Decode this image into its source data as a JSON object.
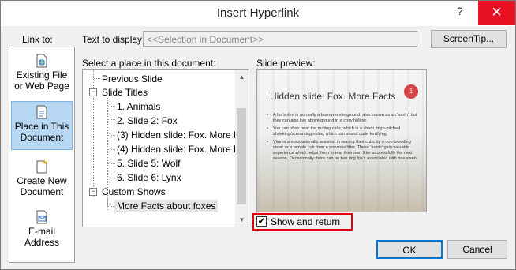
{
  "window": {
    "title": "Insert Hyperlink",
    "help": "?",
    "close": "✕"
  },
  "link_to": {
    "label": "Link to:",
    "items": [
      {
        "line1": "Existing File",
        "line2": "or Web Page",
        "icon": "globe-file-icon"
      },
      {
        "line1": "Place in This",
        "line2": "Document",
        "icon": "document-place-icon",
        "selected": true
      },
      {
        "line1": "Create New",
        "line2": "Document",
        "icon": "new-document-icon"
      },
      {
        "line1": "E-mail",
        "line2": "Address",
        "icon": "email-icon"
      }
    ]
  },
  "text_to_display": {
    "label": "Text to display:",
    "value": "<<Selection in Document>>"
  },
  "screentip": {
    "label": "ScreenTip..."
  },
  "place": {
    "label": "Select a place in this document:",
    "items": [
      {
        "text": "Previous Slide"
      },
      {
        "text": "Slide Titles"
      },
      {
        "text": "1. Animals"
      },
      {
        "text": "2. Slide 2: Fox"
      },
      {
        "text": "(3) Hidden slide: Fox. More F"
      },
      {
        "text": "(4) Hidden slide: Fox. More F"
      },
      {
        "text": "5. Slide 5: Wolf"
      },
      {
        "text": "6. Slide 6: Lynx"
      },
      {
        "text": "Custom Shows"
      },
      {
        "text": "More Facts about foxes",
        "selected": true
      }
    ]
  },
  "preview": {
    "label": "Slide preview:",
    "slide_title": "Hidden slide: Fox. More Facts",
    "slide_number": "1",
    "bullets": [
      "A fox's den is normally a burrow underground, also known as an 'earth', but they can also live above ground in a cosy hollow.",
      "You can often hear the mating calls, which is a sharp, high-pitched shrieking/screaming noise, which can sound quite terrifying.",
      "Vixens are occasionally assisted in rearing their cubs by a non-breeding sister or a female cub from a previous litter. These 'aunts' gain valuable experience which helps them to rear their own litter successfully the next season. Occasionally there can be two dog fox's associated with one vixen."
    ]
  },
  "show_and_return": {
    "label": "Show and return",
    "checked": true,
    "mark": "✔"
  },
  "buttons": {
    "ok": "OK",
    "cancel": "Cancel"
  },
  "colors": {
    "accent_selection": "#b7d7f3",
    "highlight_border": "#e2000f",
    "close_button": "#e81123"
  }
}
